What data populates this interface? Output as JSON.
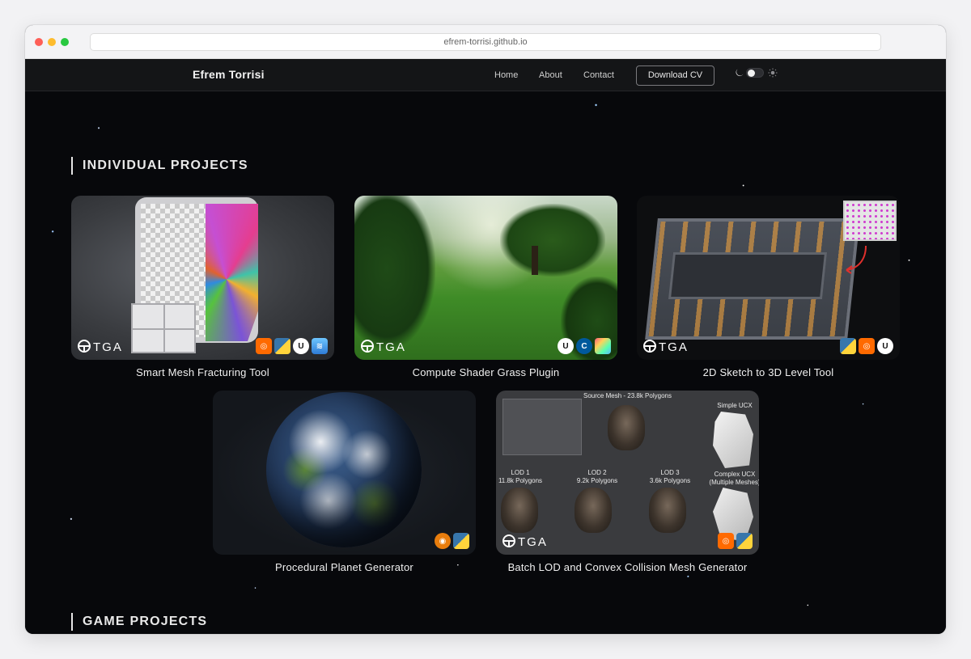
{
  "browser": {
    "url": "efrem-torrisi.github.io"
  },
  "nav": {
    "brand": "Efrem Torrisi",
    "links": [
      "Home",
      "About",
      "Contact"
    ],
    "cv_button": "Download CV",
    "theme_toggle": {
      "dark_icon": "moon-icon",
      "light_icon": "sun-icon",
      "state": "dark"
    }
  },
  "sections": {
    "individual": "INDIVIDUAL PROJECTS",
    "game": "GAME PROJECTS"
  },
  "projects": [
    {
      "title": "Smart Mesh Fracturing Tool",
      "logo": "TGA",
      "badges": [
        "houdini-icon",
        "python-icon",
        "unreal-icon",
        "vex-icon"
      ]
    },
    {
      "title": "Compute Shader Grass Plugin",
      "logo": "TGA",
      "badges": [
        "unreal-icon",
        "cpp-icon",
        "hlsl-icon"
      ]
    },
    {
      "title": "2D Sketch to 3D Level Tool",
      "logo": "TGA",
      "badges": [
        "python-icon",
        "houdini-icon",
        "unreal-icon"
      ]
    },
    {
      "title": "Procedural Planet Generator",
      "logo": "",
      "badges": [
        "blender-icon",
        "python-icon"
      ]
    },
    {
      "title": "Batch LOD and Convex Collision Mesh Generator",
      "logo": "TGA",
      "badges": [
        "houdini-icon",
        "python-icon"
      ],
      "image_text": {
        "source": "Source Mesh - 23.8k Polygons",
        "simple": "Simple UCX",
        "lod1": [
          "LOD 1",
          "11.8k Polygons"
        ],
        "lod2": [
          "LOD 2",
          "9.2k Polygons"
        ],
        "lod3": [
          "LOD 3",
          "3.6k Polygons"
        ],
        "complex": [
          "Complex UCX",
          "(Multiple Meshes)"
        ]
      }
    }
  ],
  "colors": {
    "background": "#07080b",
    "nav": "#141517",
    "houdini": "#ff6a00",
    "python_blue": "#3776ab",
    "python_yellow": "#ffd43b",
    "cpp": "#00599c",
    "blender": "#e87d0d"
  }
}
